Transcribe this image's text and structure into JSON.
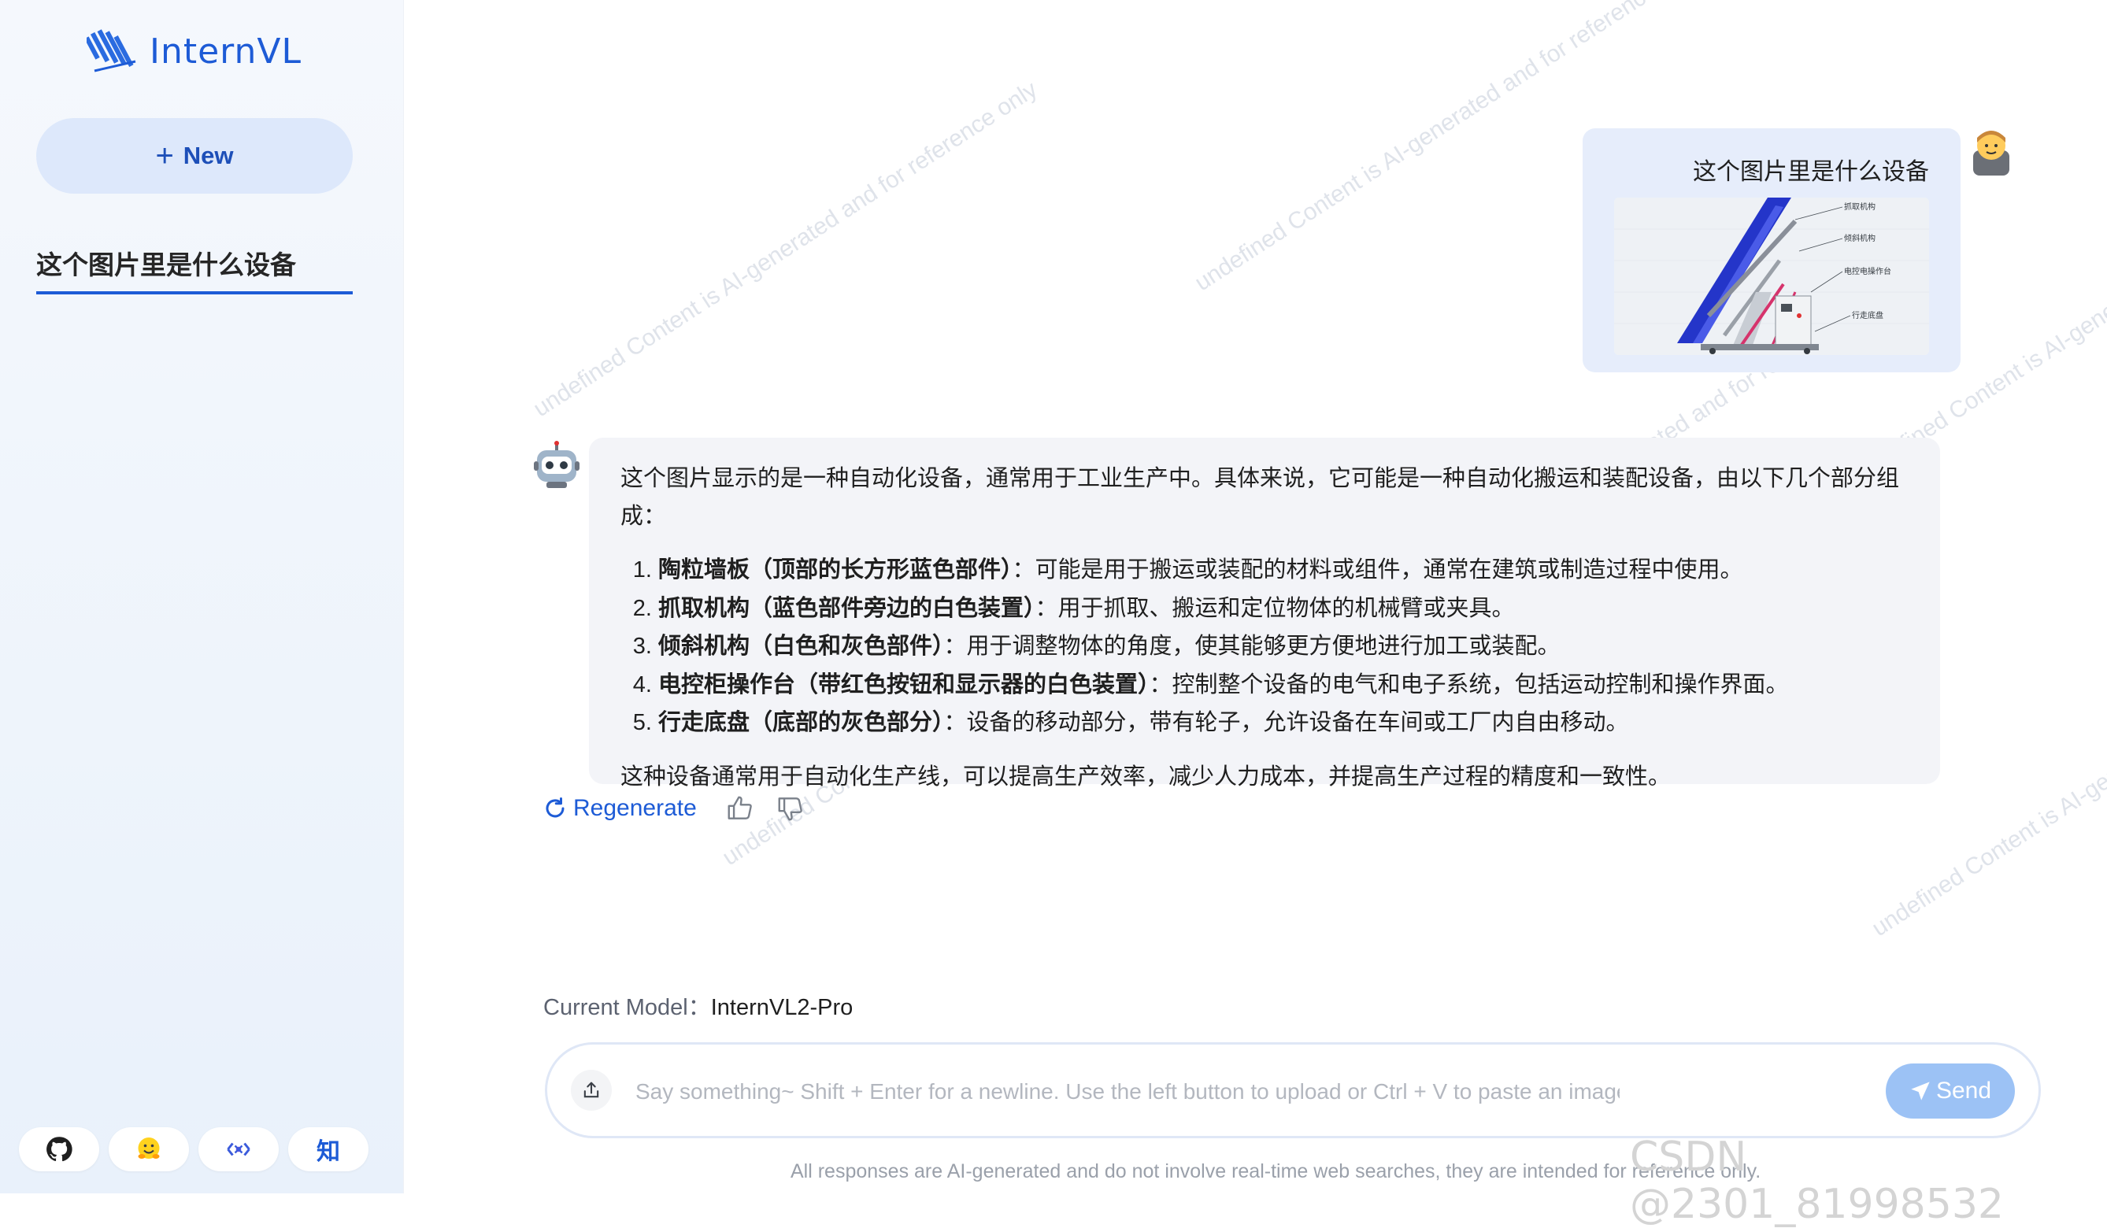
{
  "app": {
    "name": "InternVL"
  },
  "sidebar": {
    "new_label": "New",
    "conversations": [
      {
        "title": "这个图片里是什么设备"
      }
    ],
    "footer_links": [
      "github",
      "huggingface",
      "openxlab",
      "知"
    ]
  },
  "user_message": {
    "text": "这个图片里是什么设备",
    "image_labels": [
      "抓取机构",
      "倾斜机构",
      "电控电操作台",
      "行走底盘"
    ]
  },
  "bot_message": {
    "intro": "这个图片显示的是一种自动化设备，通常用于工业生产中。具体来说，它可能是一种自动化搬运和装配设备，由以下几个部分组成：",
    "items": [
      {
        "title": "陶粒墙板（顶部的长方形蓝色部件）",
        "desc": "：可能是用于搬运或装配的材料或组件，通常在建筑或制造过程中使用。"
      },
      {
        "title": "抓取机构（蓝色部件旁边的白色装置）",
        "desc": "：用于抓取、搬运和定位物体的机械臂或夹具。"
      },
      {
        "title": "倾斜机构（白色和灰色部件）",
        "desc": "：用于调整物体的角度，使其能够更方便地进行加工或装配。"
      },
      {
        "title": "电控柜操作台（带红色按钮和显示器的白色装置）",
        "desc": "：控制整个设备的电气和电子系统，包括运动控制和操作界面。"
      },
      {
        "title": "行走底盘（底部的灰色部分）",
        "desc": "：设备的移动部分，带有轮子，允许设备在车间或工厂内自由移动。"
      }
    ],
    "conclusion": "这种设备通常用于自动化生产线，可以提高生产效率，减少人力成本，并提高生产过程的精度和一致性。"
  },
  "actions": {
    "regenerate_label": "Regenerate"
  },
  "model": {
    "label": "Current Model：",
    "name": "InternVL2-Pro"
  },
  "input": {
    "placeholder": "Say something~ Shift + Enter for a newline. Use the left button to upload or Ctrl + V to paste an image.",
    "value": "",
    "send_label": "Send"
  },
  "disclaimer": "All responses are AI-generated and do not involve real-time web searches, they are intended for reference only.",
  "watermark_text": "undefined Content is AI-generated and for reference only",
  "csdn_watermark": "CSDN @2301_81998532",
  "colors": {
    "accent": "#1d5bd6",
    "send": "#9cc2f5",
    "user_bubble": "#e6edfb",
    "bot_bubble": "#f3f4f8"
  }
}
